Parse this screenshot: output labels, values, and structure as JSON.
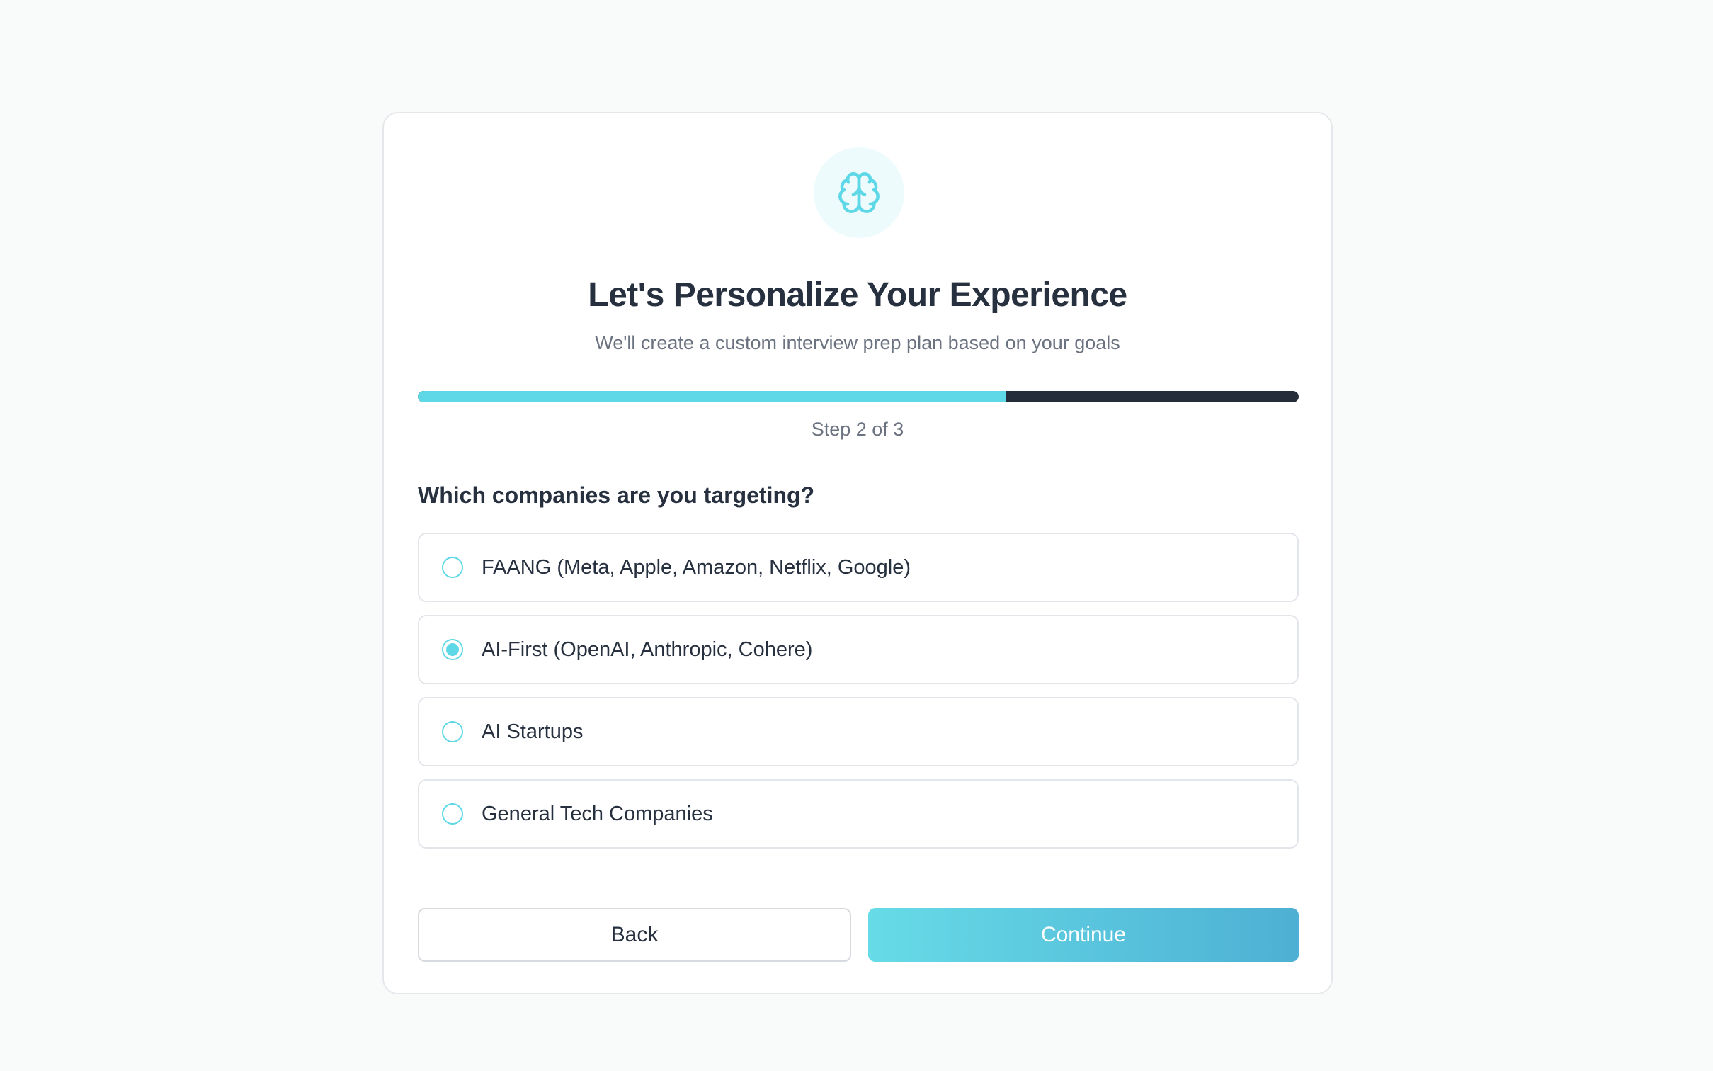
{
  "header": {
    "logo_icon": "brain-icon",
    "title": "Let's Personalize Your Experience",
    "subtitle": "We'll create a custom interview prep plan based on your goals"
  },
  "progress": {
    "current_step": 2,
    "total_steps": 3,
    "fraction_complete": 0.667,
    "label": "Step 2 of 3"
  },
  "question": {
    "text": "Which companies are you targeting?",
    "options": [
      {
        "label": "FAANG (Meta, Apple, Amazon, Netflix, Google)",
        "selected": false
      },
      {
        "label": "AI-First (OpenAI, Anthropic, Cohere)",
        "selected": true
      },
      {
        "label": "AI Startups",
        "selected": false
      },
      {
        "label": "General Tech Companies",
        "selected": false
      }
    ]
  },
  "actions": {
    "back_label": "Back",
    "continue_label": "Continue"
  },
  "colors": {
    "accent": "#5ed8e6",
    "progress_track": "#252d3b",
    "heading": "#27303f",
    "muted": "#6b7280",
    "continue_gradient_start": "#67dbe7",
    "continue_gradient_end": "#4db0d4"
  }
}
